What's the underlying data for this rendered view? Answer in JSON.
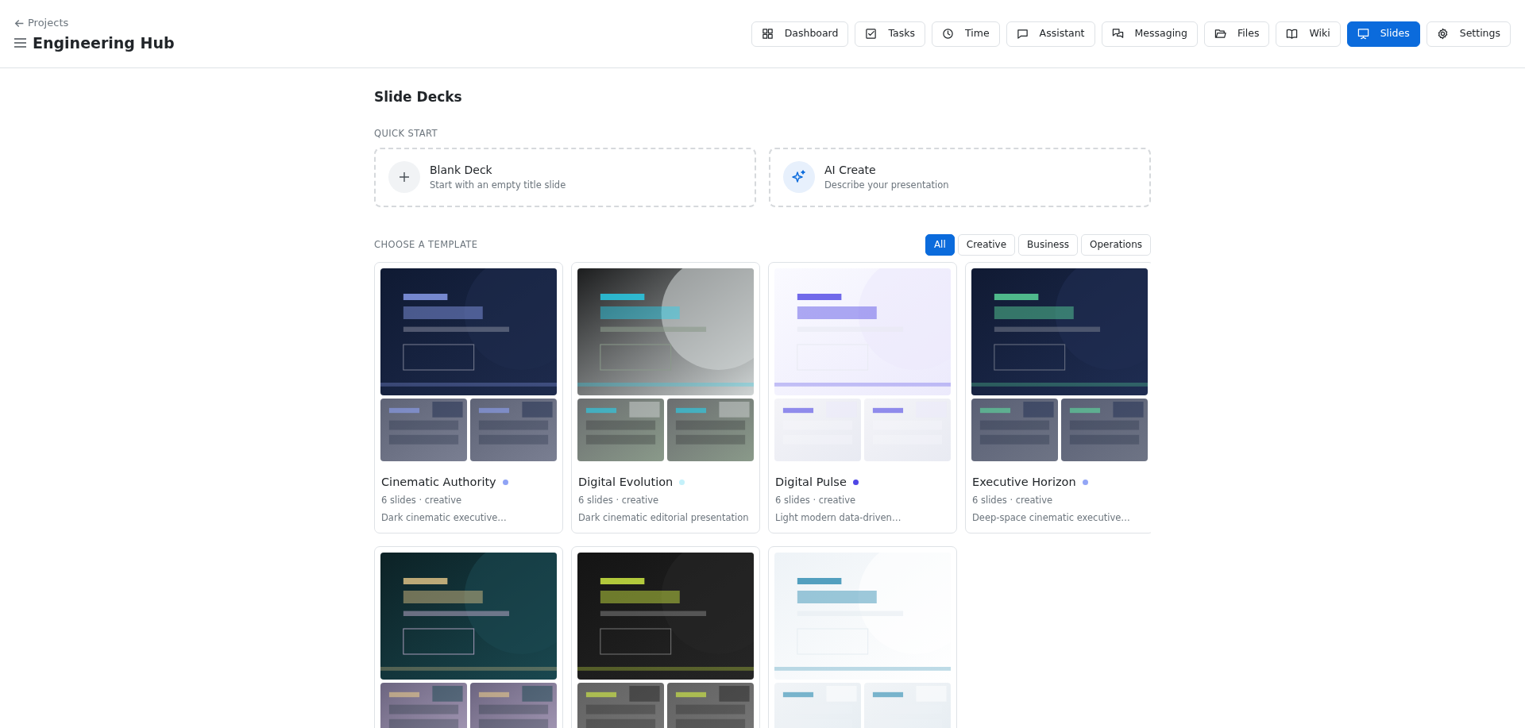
{
  "header": {
    "back_link": "Projects",
    "title": "Engineering Hub"
  },
  "nav": [
    {
      "label": "Dashboard",
      "selected": false
    },
    {
      "label": "Tasks",
      "selected": false
    },
    {
      "label": "Time",
      "selected": false
    },
    {
      "label": "Assistant",
      "selected": false
    },
    {
      "label": "Messaging",
      "selected": false
    },
    {
      "label": "Files",
      "selected": false
    },
    {
      "label": "Wiki",
      "selected": false
    },
    {
      "label": "Slides",
      "selected": true
    },
    {
      "label": "Settings",
      "selected": false
    }
  ],
  "page_title": "Slide Decks",
  "quick_start": {
    "heading": "QUICK START",
    "actions": [
      {
        "kind": "blank",
        "title": "Blank Deck",
        "subtitle": "Start with an empty title slide"
      },
      {
        "kind": "ai",
        "title": "AI Create",
        "subtitle": "Describe your presentation"
      }
    ]
  },
  "templates": {
    "heading": "CHOOSE A TEMPLATE",
    "filters": [
      {
        "label": "All",
        "selected": true
      },
      {
        "label": "Creative",
        "selected": false
      },
      {
        "label": "Business",
        "selected": false
      },
      {
        "label": "Operations",
        "selected": false
      }
    ],
    "items": [
      {
        "kind": "picture",
        "name": "Cinematic Authority",
        "color": "#8fa3f5",
        "meta": "6 slides · creative",
        "description": "Dark cinematic executive…"
      },
      {
        "kind": "picture",
        "name": "Digital Evolution",
        "color": "#c4f1fa",
        "meta": "6 slides · creative",
        "description": "Dark cinematic editorial presentation"
      },
      {
        "kind": "picture",
        "name": "Digital Pulse",
        "color": "#4f46e5",
        "meta": "6 slides · creative",
        "description": "Light modern data-driven…"
      },
      {
        "kind": "picture",
        "name": "Executive Horizon",
        "color": "#93a6f6",
        "meta": "6 slides · creative",
        "description": "Deep-space cinematic executive…"
      },
      {
        "kind": "picture"
      },
      {
        "kind": "picture"
      },
      {
        "kind": "picture"
      }
    ]
  }
}
